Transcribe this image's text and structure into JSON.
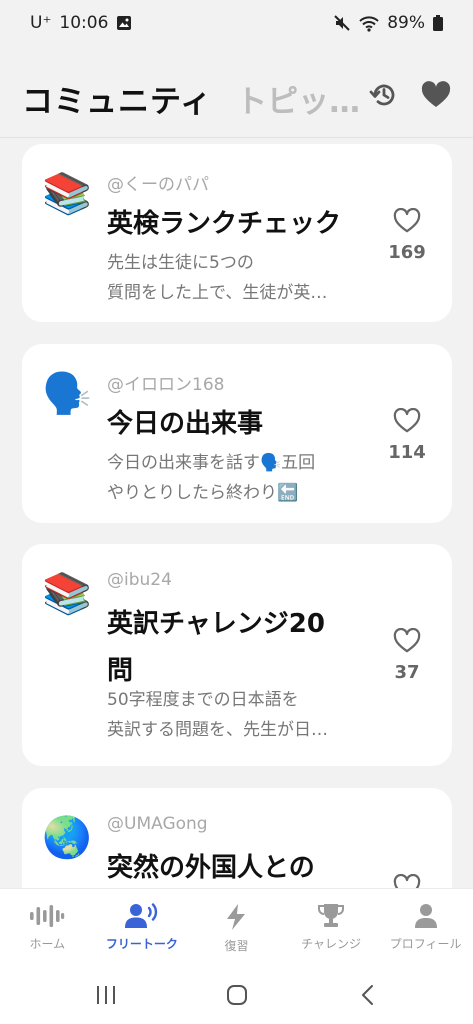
{
  "status_bar": {
    "carrier": "U⁺",
    "time": "10:06",
    "battery": "89%"
  },
  "header": {
    "title": "コミュニティ",
    "tab_topics": "トピッ…"
  },
  "posts": [
    {
      "emoji": "📚",
      "author": "@くーのパパ",
      "title": "英検ランクチェック",
      "description": [
        "先生は生徒に5つの",
        "質問をした上で、生徒が英…"
      ],
      "likes": "169"
    },
    {
      "emoji": "🗣️",
      "author": "@イロロン168",
      "title": "今日の出来事",
      "description": [
        "今日の出来事を話す🗣️五回",
        "やりとりしたら終わり🔚"
      ],
      "likes": "114"
    },
    {
      "emoji": "📚",
      "author": "@ibu24",
      "title": "英訳チャレンジ20問",
      "description": [
        "50字程度までの日本語を",
        "英訳する問題を、先生が日…"
      ],
      "likes": "37"
    },
    {
      "emoji": "🌏",
      "author": "@UMAGong",
      "title": "突然の外国人との",
      "description": [],
      "likes": ""
    }
  ],
  "bottom_nav": [
    {
      "label": "ホーム",
      "icon": "soundwave-icon",
      "active": false
    },
    {
      "label": "フリートーク",
      "icon": "speaking-person-icon",
      "active": true
    },
    {
      "label": "復習",
      "icon": "lightning-icon",
      "active": false
    },
    {
      "label": "チャレンジ",
      "icon": "trophy-icon",
      "active": false
    },
    {
      "label": "プロフィール",
      "icon": "person-icon",
      "active": false
    }
  ],
  "colors": {
    "accent": "#3a63d8",
    "background": "#f2f2f2",
    "card": "#ffffff",
    "muted_text": "#777777"
  }
}
